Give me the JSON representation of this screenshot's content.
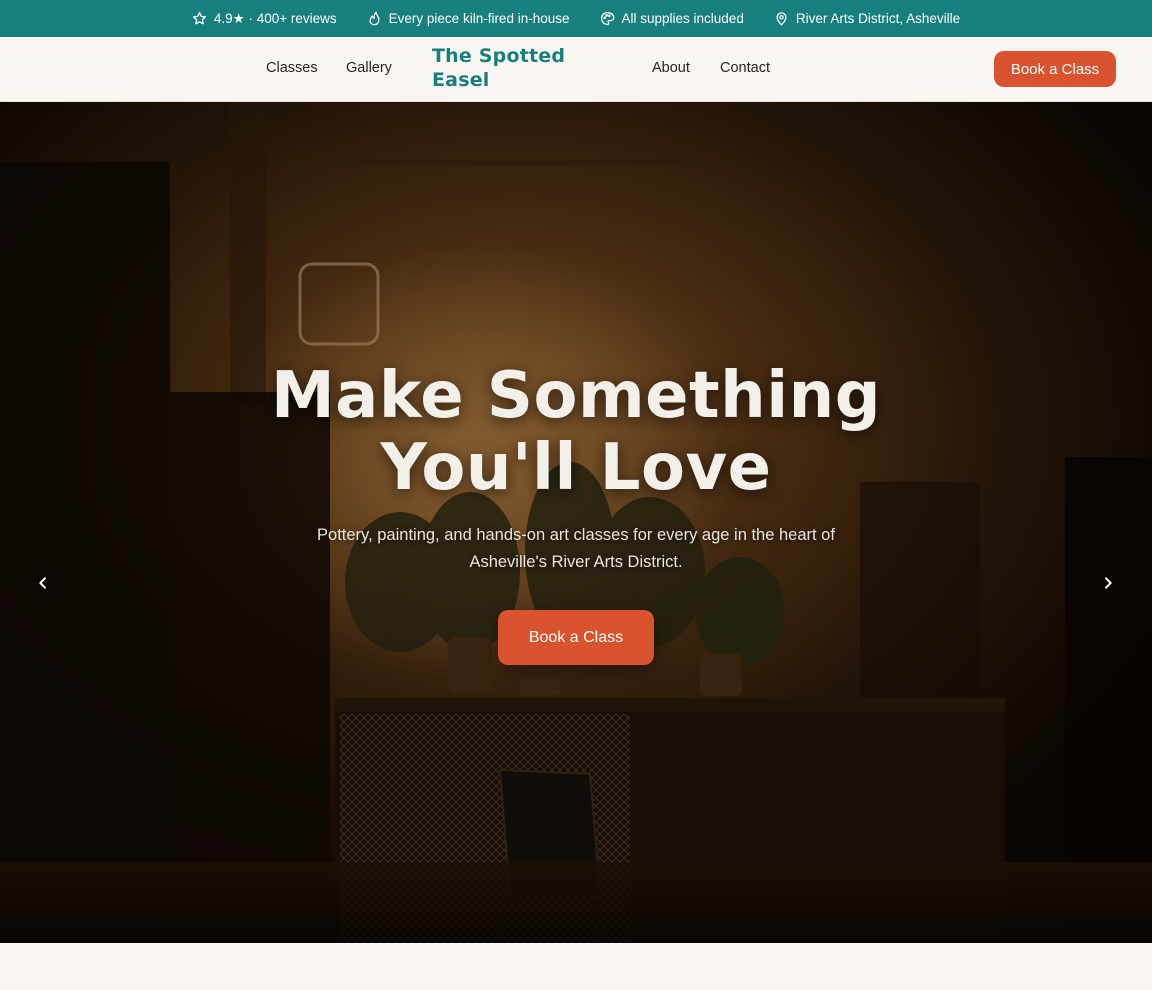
{
  "topbar": {
    "items": [
      {
        "icon": "star-icon",
        "text": "4.9★ · 400+ reviews"
      },
      {
        "icon": "flame-icon",
        "text": "Every piece kiln-fired in-house"
      },
      {
        "icon": "palette-icon",
        "text": "All supplies included"
      },
      {
        "icon": "map-pin-icon",
        "text": "River Arts District, Asheville"
      }
    ]
  },
  "nav": {
    "classes": "Classes",
    "gallery": "Gallery",
    "about": "About",
    "contact": "Contact"
  },
  "logo": {
    "line1": "The Spotted",
    "line2": "Easel"
  },
  "header": {
    "cta_label": "Book a Class"
  },
  "hero": {
    "title_line1": "Make Something",
    "title_line2": "You'll Love",
    "subtitle_line1": "Pottery, painting, and hands-on art classes for every age in the heart of",
    "subtitle_line2": "Asheville's River Arts District.",
    "cta_label": "Book a Class",
    "prev_icon": "chevron-left-icon",
    "next_icon": "chevron-right-icon"
  },
  "colors": {
    "brand_teal": "#17807e",
    "accent_orange": "#d9532e",
    "page_background": "#faf6f1"
  }
}
